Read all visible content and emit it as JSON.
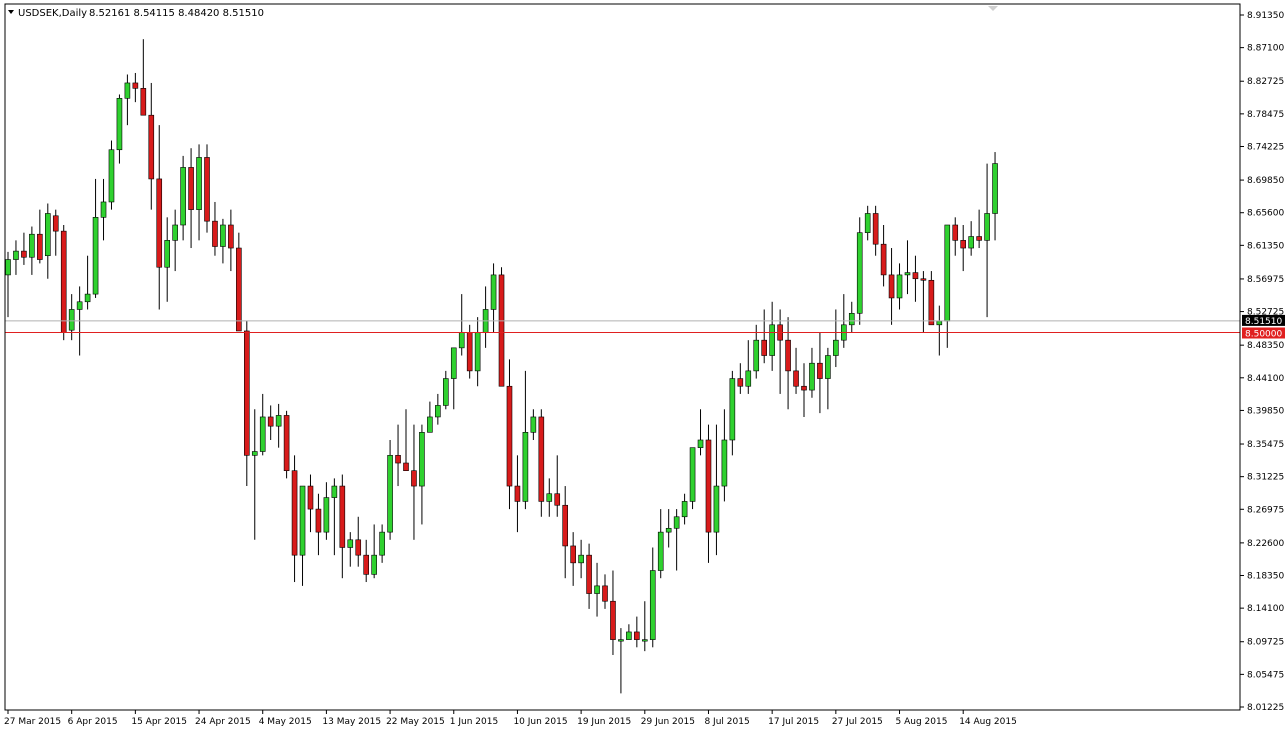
{
  "header": {
    "symbol": "USDSEK,Daily",
    "ohlc": "8.52161 8.54115 8.48420 8.51510"
  },
  "current_price_label": "8.51510",
  "level_label": "8.50000",
  "colors": {
    "bull": "#2fd12f",
    "bear": "#d81b1b",
    "wick": "#000000",
    "level_line": "#e02020",
    "price_line": "#b0b0b0",
    "price_tag_bg": "#000000",
    "level_tag_bg": "#e02020",
    "background": "#ffffff",
    "frame": "#000000"
  },
  "chart_data": {
    "type": "candlestick",
    "ylim": [
      8.01,
      8.92
    ],
    "y_ticks": [
      "8.91350",
      "8.87100",
      "8.82725",
      "8.78475",
      "8.74225",
      "8.69850",
      "8.65600",
      "8.61350",
      "8.56975",
      "8.52725",
      "8.48350",
      "8.44100",
      "8.39850",
      "8.35475",
      "8.31225",
      "8.26975",
      "8.22600",
      "8.18350",
      "8.14100",
      "8.09725",
      "8.05475",
      "8.01225"
    ],
    "x_ticks": [
      {
        "label": "27 Mar 2015",
        "index": 0
      },
      {
        "label": "6 Apr 2015",
        "index": 8
      },
      {
        "label": "15 Apr 2015",
        "index": 16
      },
      {
        "label": "24 Apr 2015",
        "index": 24
      },
      {
        "label": "4 May 2015",
        "index": 32
      },
      {
        "label": "13 May 2015",
        "index": 40
      },
      {
        "label": "22 May 2015",
        "index": 48
      },
      {
        "label": "1 Jun 2015",
        "index": 56
      },
      {
        "label": "10 Jun 2015",
        "index": 64
      },
      {
        "label": "19 Jun 2015",
        "index": 72
      },
      {
        "label": "29 Jun 2015",
        "index": 80
      },
      {
        "label": "8 Jul 2015",
        "index": 88
      },
      {
        "label": "17 Jul 2015",
        "index": 96
      },
      {
        "label": "27 Jul 2015",
        "index": 104
      },
      {
        "label": "5 Aug 2015",
        "index": 112
      },
      {
        "label": "14 Aug 2015",
        "index": 120
      }
    ],
    "level_line": 8.5,
    "last_close": 8.5151,
    "candles": [
      [
        8.575,
        8.605,
        8.52,
        8.595
      ],
      [
        8.595,
        8.62,
        8.575,
        8.606
      ],
      [
        8.606,
        8.63,
        8.588,
        8.598
      ],
      [
        8.598,
        8.638,
        8.575,
        8.628
      ],
      [
        8.628,
        8.66,
        8.59,
        8.595
      ],
      [
        8.6,
        8.668,
        8.57,
        8.655
      ],
      [
        8.652,
        8.66,
        8.6,
        8.632
      ],
      [
        8.632,
        8.64,
        8.49,
        8.5
      ],
      [
        8.503,
        8.55,
        8.49,
        8.53
      ],
      [
        8.53,
        8.56,
        8.47,
        8.54
      ],
      [
        8.54,
        8.6,
        8.53,
        8.55
      ],
      [
        8.55,
        8.7,
        8.545,
        8.65
      ],
      [
        8.65,
        8.7,
        8.62,
        8.67
      ],
      [
        8.67,
        8.75,
        8.66,
        8.738
      ],
      [
        8.738,
        8.81,
        8.72,
        8.805
      ],
      [
        8.805,
        8.836,
        8.77,
        8.825
      ],
      [
        8.825,
        8.838,
        8.8,
        8.818
      ],
      [
        8.818,
        8.882,
        8.8,
        8.783
      ],
      [
        8.783,
        8.825,
        8.66,
        8.7
      ],
      [
        8.7,
        8.77,
        8.53,
        8.585
      ],
      [
        8.585,
        8.65,
        8.54,
        8.62
      ],
      [
        8.62,
        8.66,
        8.58,
        8.64
      ],
      [
        8.64,
        8.73,
        8.62,
        8.715
      ],
      [
        8.715,
        8.74,
        8.61,
        8.66
      ],
      [
        8.66,
        8.745,
        8.62,
        8.728
      ],
      [
        8.728,
        8.745,
        8.63,
        8.645
      ],
      [
        8.645,
        8.67,
        8.6,
        8.612
      ],
      [
        8.612,
        8.648,
        8.59,
        8.64
      ],
      [
        8.64,
        8.66,
        8.58,
        8.61
      ],
      [
        8.61,
        8.63,
        8.51,
        8.502
      ],
      [
        8.502,
        8.515,
        8.3,
        8.34
      ],
      [
        8.34,
        8.4,
        8.23,
        8.345
      ],
      [
        8.345,
        8.42,
        8.34,
        8.39
      ],
      [
        8.39,
        8.405,
        8.36,
        8.378
      ],
      [
        8.378,
        8.407,
        8.35,
        8.392
      ],
      [
        8.392,
        8.398,
        8.31,
        8.32
      ],
      [
        8.32,
        8.34,
        8.175,
        8.21
      ],
      [
        8.21,
        8.3,
        8.17,
        8.3
      ],
      [
        8.3,
        8.315,
        8.24,
        8.27
      ],
      [
        8.27,
        8.29,
        8.21,
        8.24
      ],
      [
        8.24,
        8.305,
        8.23,
        8.285
      ],
      [
        8.285,
        8.31,
        8.21,
        8.3
      ],
      [
        8.3,
        8.315,
        8.18,
        8.22
      ],
      [
        8.22,
        8.24,
        8.195,
        8.23
      ],
      [
        8.23,
        8.26,
        8.195,
        8.21
      ],
      [
        8.21,
        8.23,
        8.175,
        8.185
      ],
      [
        8.185,
        8.25,
        8.18,
        8.21
      ],
      [
        8.21,
        8.25,
        8.2,
        8.24
      ],
      [
        8.24,
        8.36,
        8.23,
        8.34
      ],
      [
        8.34,
        8.38,
        8.3,
        8.33
      ],
      [
        8.33,
        8.4,
        8.32,
        8.32
      ],
      [
        8.32,
        8.38,
        8.23,
        8.3
      ],
      [
        8.3,
        8.38,
        8.25,
        8.37
      ],
      [
        8.37,
        8.41,
        8.37,
        8.39
      ],
      [
        8.39,
        8.42,
        8.38,
        8.405
      ],
      [
        8.405,
        8.45,
        8.4,
        8.44
      ],
      [
        8.44,
        8.48,
        8.4,
        8.48
      ],
      [
        8.48,
        8.55,
        8.47,
        8.5
      ],
      [
        8.5,
        8.51,
        8.44,
        8.45
      ],
      [
        8.45,
        8.52,
        8.43,
        8.5
      ],
      [
        8.5,
        8.56,
        8.48,
        8.53
      ],
      [
        8.53,
        8.59,
        8.5,
        8.575
      ],
      [
        8.575,
        8.585,
        8.5,
        8.43
      ],
      [
        8.43,
        8.465,
        8.27,
        8.3
      ],
      [
        8.3,
        8.34,
        8.24,
        8.28
      ],
      [
        8.28,
        8.45,
        8.27,
        8.37
      ],
      [
        8.37,
        8.4,
        8.36,
        8.39
      ],
      [
        8.39,
        8.4,
        8.26,
        8.28
      ],
      [
        8.28,
        8.31,
        8.26,
        8.29
      ],
      [
        8.29,
        8.34,
        8.26,
        8.275
      ],
      [
        8.275,
        8.3,
        8.18,
        8.222
      ],
      [
        8.222,
        8.24,
        8.17,
        8.2
      ],
      [
        8.2,
        8.23,
        8.18,
        8.21
      ],
      [
        8.21,
        8.225,
        8.14,
        8.16
      ],
      [
        8.16,
        8.2,
        8.13,
        8.17
      ],
      [
        8.17,
        8.185,
        8.14,
        8.15
      ],
      [
        8.15,
        8.19,
        8.08,
        8.1
      ],
      [
        8.1,
        8.115,
        8.03,
        8.1
      ],
      [
        8.1,
        8.12,
        8.1,
        8.11
      ],
      [
        8.11,
        8.13,
        8.09,
        8.1
      ],
      [
        8.1,
        8.15,
        8.085,
        8.1
      ],
      [
        8.1,
        8.22,
        8.09,
        8.19
      ],
      [
        8.19,
        8.27,
        8.18,
        8.24
      ],
      [
        8.24,
        8.27,
        8.22,
        8.245
      ],
      [
        8.245,
        8.27,
        8.19,
        8.26
      ],
      [
        8.26,
        8.29,
        8.25,
        8.28
      ],
      [
        8.28,
        8.34,
        8.27,
        8.35
      ],
      [
        8.35,
        8.4,
        8.34,
        8.36
      ],
      [
        8.36,
        8.38,
        8.2,
        8.24
      ],
      [
        8.24,
        8.38,
        8.21,
        8.3
      ],
      [
        8.3,
        8.4,
        8.28,
        8.36
      ],
      [
        8.36,
        8.45,
        8.34,
        8.44
      ],
      [
        8.44,
        8.46,
        8.42,
        8.43
      ],
      [
        8.43,
        8.49,
        8.42,
        8.45
      ],
      [
        8.45,
        8.51,
        8.44,
        8.49
      ],
      [
        8.49,
        8.53,
        8.46,
        8.47
      ],
      [
        8.47,
        8.54,
        8.45,
        8.51
      ],
      [
        8.51,
        8.53,
        8.42,
        8.49
      ],
      [
        8.49,
        8.52,
        8.4,
        8.45
      ],
      [
        8.45,
        8.48,
        8.42,
        8.43
      ],
      [
        8.43,
        8.46,
        8.39,
        8.425
      ],
      [
        8.425,
        8.48,
        8.415,
        8.46
      ],
      [
        8.46,
        8.5,
        8.395,
        8.44
      ],
      [
        8.44,
        8.48,
        8.4,
        8.47
      ],
      [
        8.47,
        8.53,
        8.455,
        8.49
      ],
      [
        8.49,
        8.55,
        8.48,
        8.51
      ],
      [
        8.51,
        8.54,
        8.5,
        8.525
      ],
      [
        8.525,
        8.65,
        8.51,
        8.63
      ],
      [
        8.63,
        8.665,
        8.62,
        8.655
      ],
      [
        8.655,
        8.665,
        8.6,
        8.615
      ],
      [
        8.615,
        8.64,
        8.56,
        8.575
      ],
      [
        8.575,
        8.61,
        8.51,
        8.545
      ],
      [
        8.545,
        8.59,
        8.53,
        8.575
      ],
      [
        8.575,
        8.62,
        8.55,
        8.578
      ],
      [
        8.578,
        8.6,
        8.54,
        8.57
      ],
      [
        8.57,
        8.58,
        8.5,
        8.568
      ],
      [
        8.568,
        8.58,
        8.54,
        8.51
      ],
      [
        8.51,
        8.535,
        8.47,
        8.515
      ],
      [
        8.515,
        8.64,
        8.48,
        8.64
      ],
      [
        8.64,
        8.65,
        8.6,
        8.62
      ],
      [
        8.62,
        8.64,
        8.58,
        8.61
      ],
      [
        8.61,
        8.645,
        8.6,
        8.625
      ],
      [
        8.625,
        8.66,
        8.61,
        8.62
      ],
      [
        8.62,
        8.72,
        8.52,
        8.655
      ],
      [
        8.655,
        8.735,
        8.62,
        8.72
      ]
    ]
  }
}
